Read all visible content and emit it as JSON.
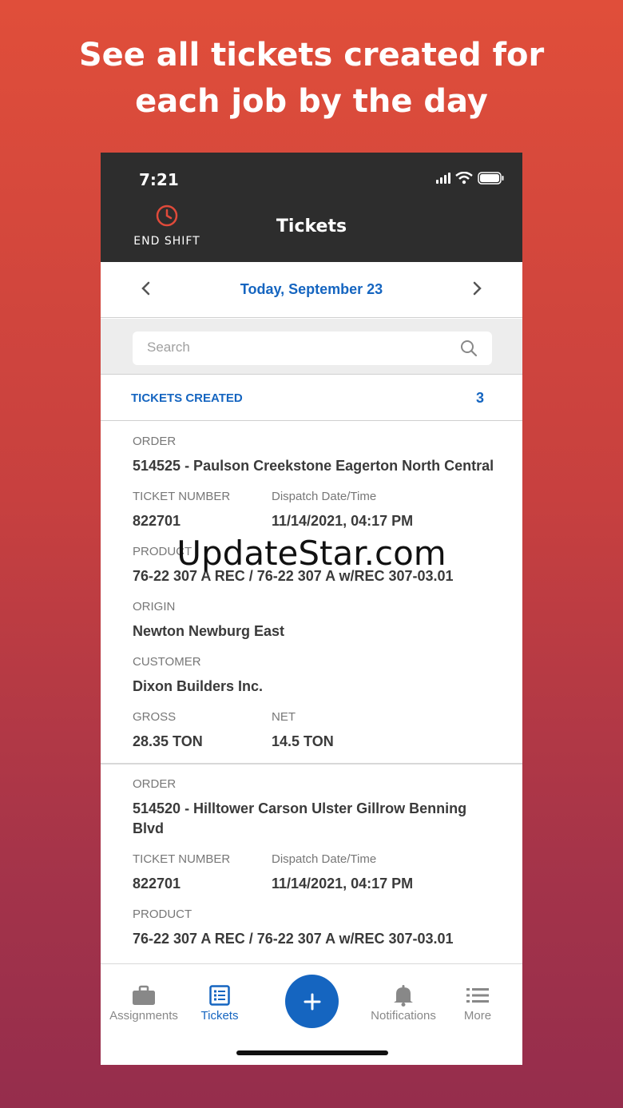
{
  "headline": [
    "See all tickets created for",
    "each job by the day"
  ],
  "status_bar": {
    "time": "7:21"
  },
  "header": {
    "end_shift_label": "END SHIFT",
    "title": "Tickets"
  },
  "date_nav": {
    "label": "Today, September 23"
  },
  "search": {
    "placeholder": "Search"
  },
  "summary": {
    "label": "TICKETS CREATED",
    "count": "3"
  },
  "field_labels": {
    "order": "ORDER",
    "ticket_number": "TICKET NUMBER",
    "dispatch": "Dispatch Date/Time",
    "product": "PRODUCT",
    "origin": "ORIGIN",
    "customer": "CUSTOMER",
    "gross": "GROSS",
    "net": "NET"
  },
  "tickets": [
    {
      "order": "514525 - Paulson Creekstone Eagerton North Central",
      "ticket_number": "822701",
      "dispatch": "11/14/2021, 04:17 PM",
      "product": "76-22 307 A REC / 76-22 307 A w/REC 307-03.01",
      "origin": "Newton Newburg East",
      "customer": "Dixon Builders Inc.",
      "gross": "28.35 TON",
      "net": "14.5 TON"
    },
    {
      "order": "514520 - Hilltower Carson Ulster Gillrow Benning Blvd",
      "ticket_number": "822701",
      "dispatch": "11/14/2021, 04:17 PM",
      "product": "76-22 307 A REC / 76-22 307 A w/REC 307-03.01"
    }
  ],
  "tabs": [
    {
      "label": "Assignments",
      "icon": "briefcase-icon"
    },
    {
      "label": "Tickets",
      "icon": "list-icon"
    },
    {
      "label": "Notifications",
      "icon": "bell-icon"
    },
    {
      "label": "More",
      "icon": "menu-icon"
    }
  ],
  "watermark": "UpdateStar.com",
  "colors": {
    "accent": "#1565c0",
    "header_bg": "#2d2d2d",
    "alert": "#e04a3a"
  }
}
